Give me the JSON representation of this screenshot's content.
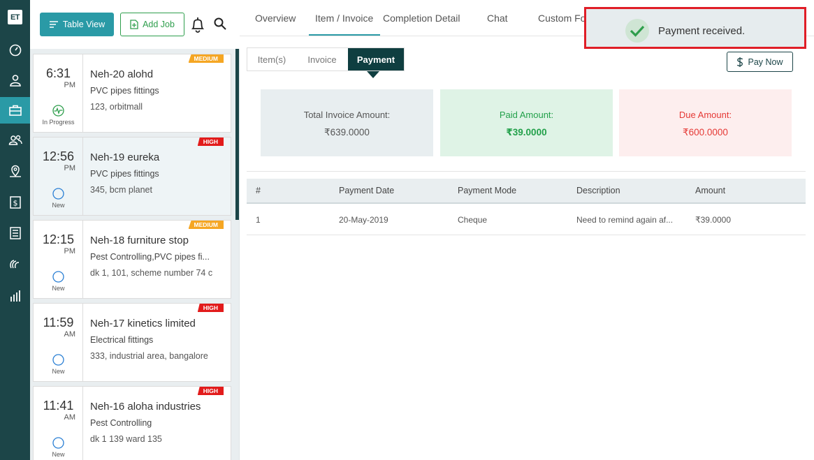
{
  "app": {
    "logo": "ET"
  },
  "rail": {
    "items": [
      {
        "icon": "dashboard-icon"
      },
      {
        "icon": "user-icon"
      },
      {
        "icon": "briefcase-icon",
        "active": true
      },
      {
        "icon": "users-icon"
      },
      {
        "icon": "map-pin-icon"
      },
      {
        "icon": "dollar-icon"
      },
      {
        "icon": "list-icon"
      },
      {
        "icon": "chat-icon"
      },
      {
        "icon": "bar-chart-icon"
      }
    ]
  },
  "toolbar": {
    "table_view": "Table View",
    "add_job": "Add Job"
  },
  "jobs": [
    {
      "time": "6:31",
      "ampm": "PM",
      "status": "In Progress",
      "title": "Neh-20 alohd",
      "service": "PVC pipes fittings",
      "address": "123, orbitmall",
      "priority": "MEDIUM"
    },
    {
      "time": "12:56",
      "ampm": "PM",
      "status": "New",
      "title": "Neh-19 eureka",
      "service": "PVC pipes fittings",
      "address": "345, bcm planet",
      "priority": "HIGH"
    },
    {
      "time": "12:15",
      "ampm": "PM",
      "status": "New",
      "title": "Neh-18 furniture stop",
      "service": "Pest Controlling,PVC pipes fi...",
      "address": "dk 1, 101, scheme number 74 c",
      "priority": "MEDIUM"
    },
    {
      "time": "11:59",
      "ampm": "AM",
      "status": "New",
      "title": "Neh-17 kinetics limited",
      "service": "Electrical fittings",
      "address": "333, industrial area, bangalore",
      "priority": "HIGH"
    },
    {
      "time": "11:41",
      "ampm": "AM",
      "status": "New",
      "title": "Neh-16 aloha industries",
      "service": "Pest Controlling",
      "address": "dk 1 139 ward 135",
      "priority": "HIGH"
    }
  ],
  "tabs": [
    "Overview",
    "Item / Invoice",
    "Completion Detail",
    "Chat",
    "Custom Fo"
  ],
  "subtabs": [
    "Item(s)",
    "Invoice",
    "Payment"
  ],
  "pay_now": "Pay Now",
  "summary": {
    "total_label": "Total Invoice Amount:",
    "total_value": "₹639.0000",
    "paid_label": "Paid Amount:",
    "paid_value": "₹39.0000",
    "due_label": "Due Amount:",
    "due_value": "₹600.0000"
  },
  "table": {
    "headers": [
      "#",
      "Payment Date",
      "Payment Mode",
      "Description",
      "Amount"
    ],
    "rows": [
      [
        "1",
        "20-May-2019",
        "Cheque",
        "Need to remind again af...",
        "₹39.0000"
      ]
    ]
  },
  "toast": {
    "message": "Payment received."
  },
  "colors": {
    "rail": "#1c4548",
    "accent": "#2a9aa6",
    "add_green": "#2e9e4c",
    "high": "#e21b1b",
    "medium": "#f5a623",
    "toast_border": "#e01e27"
  }
}
